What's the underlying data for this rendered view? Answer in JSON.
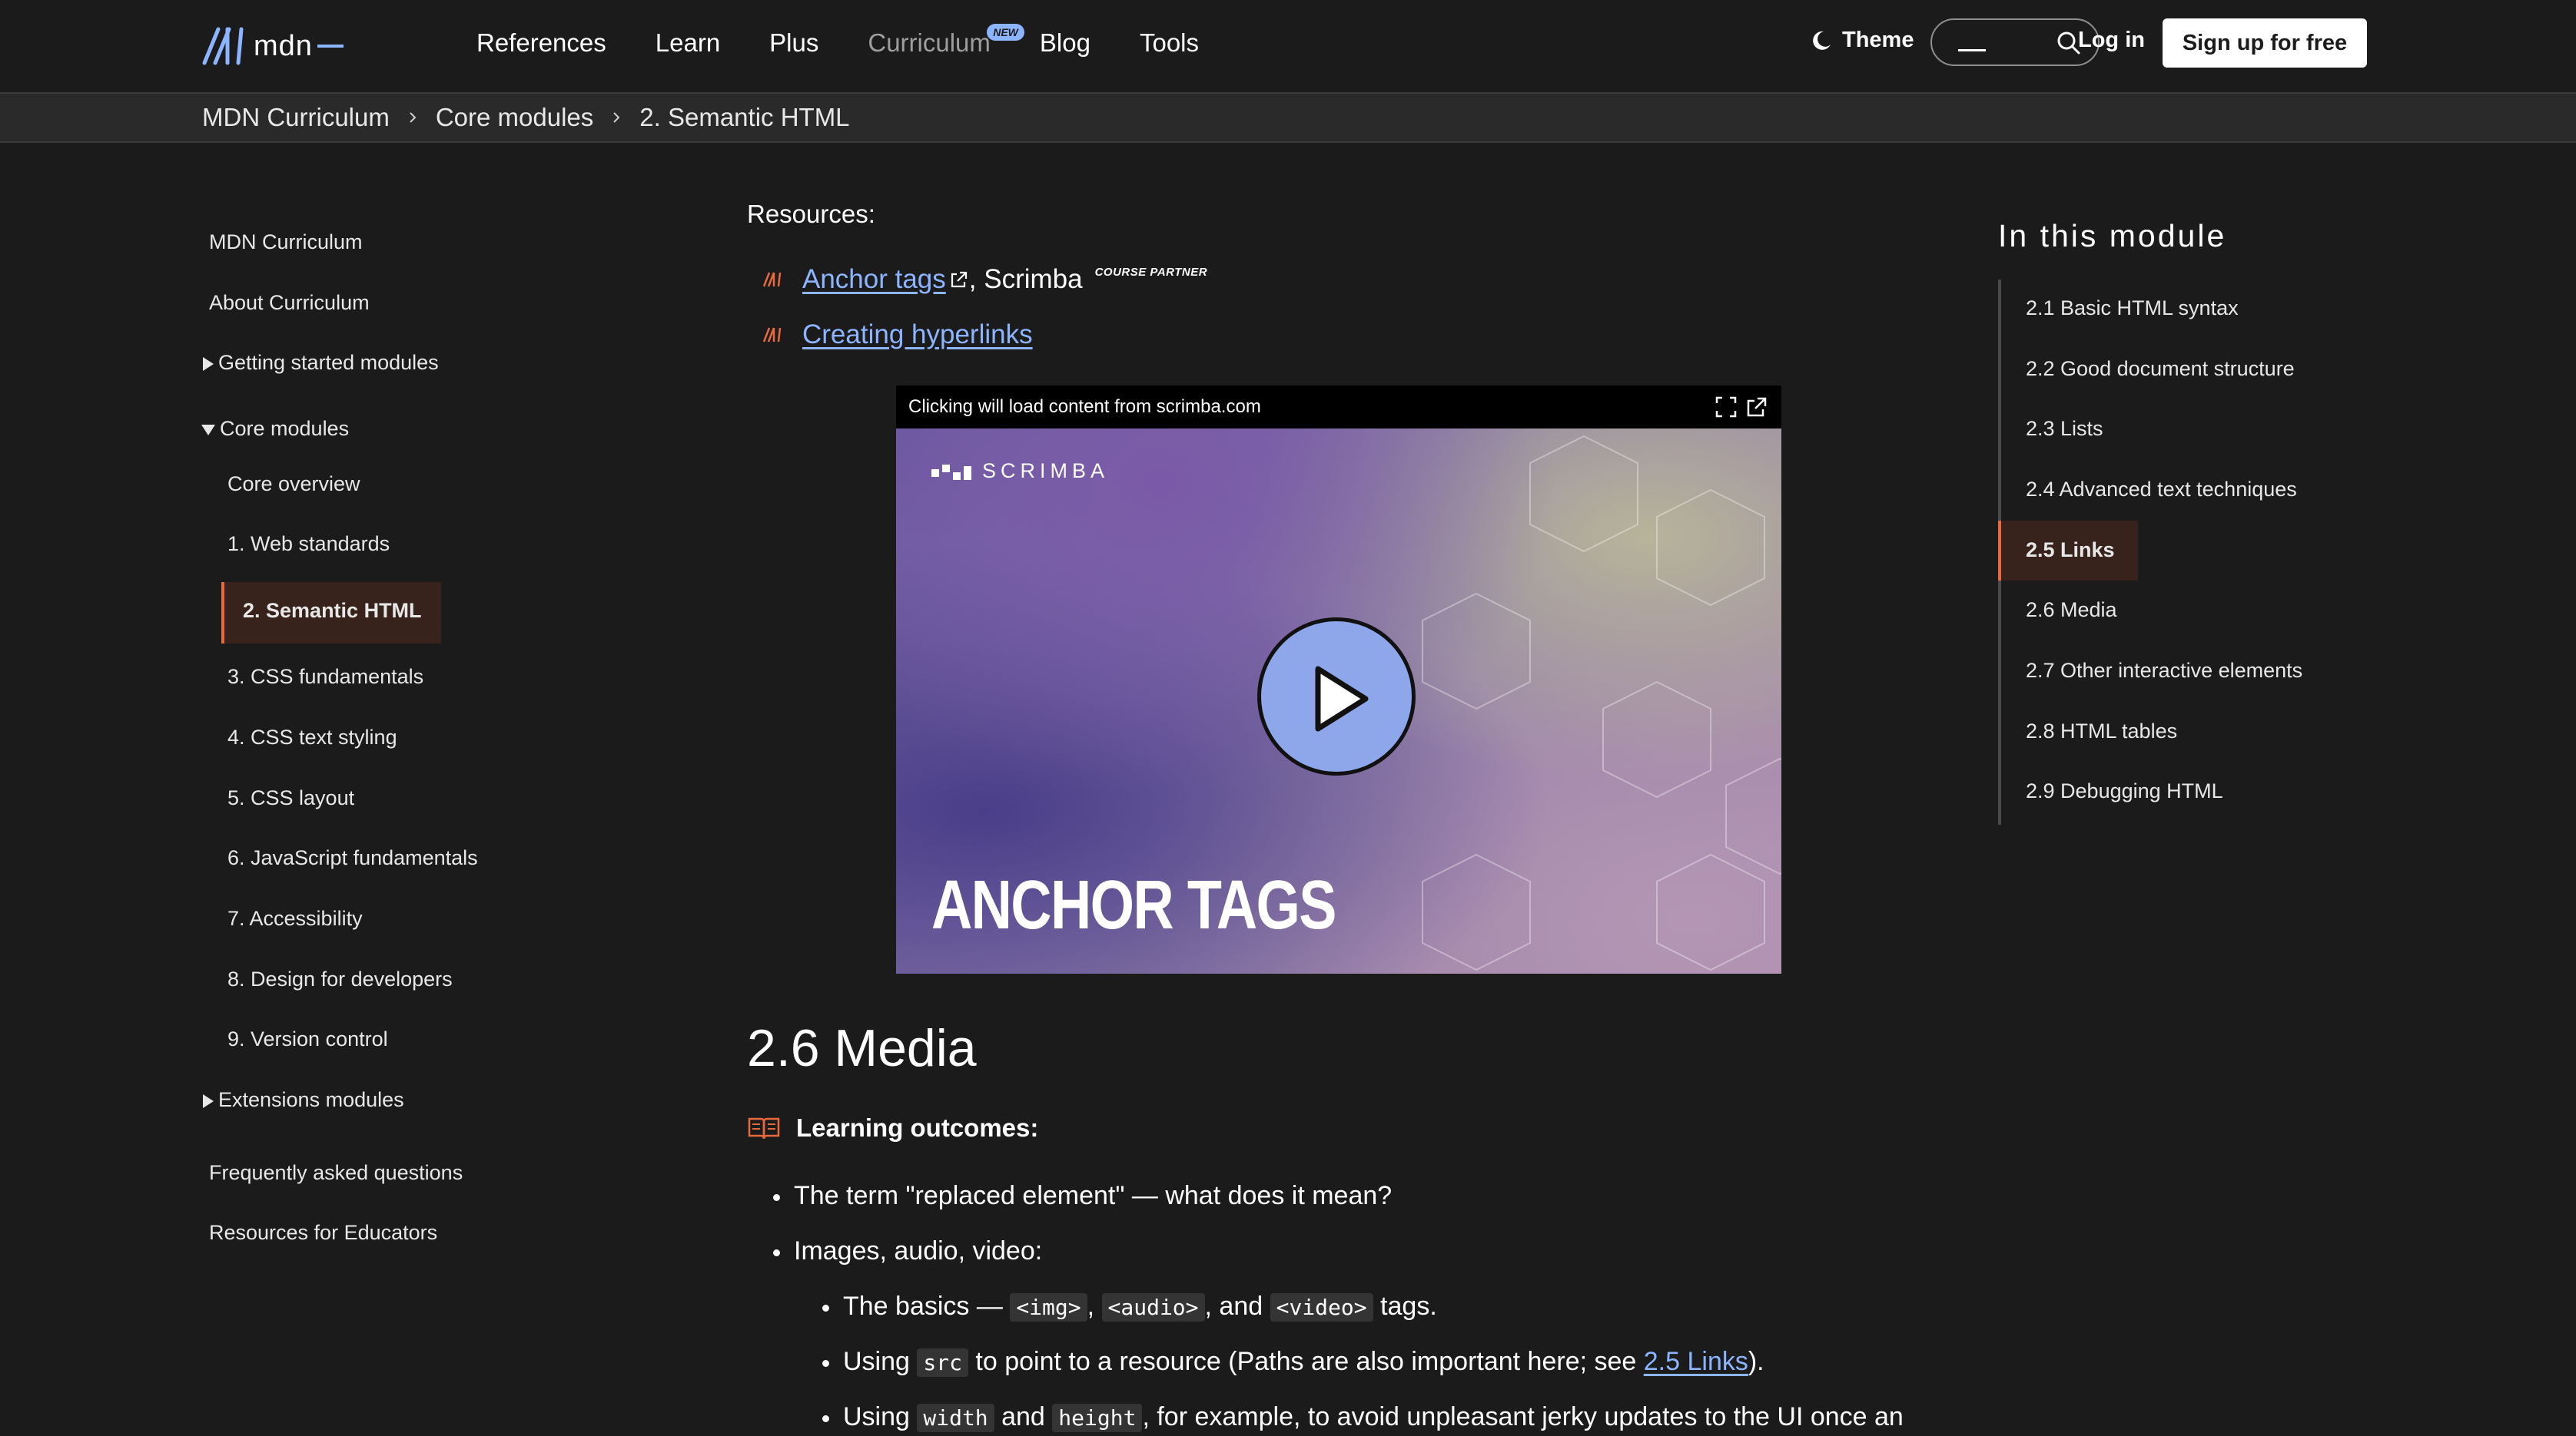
{
  "header": {
    "logo_text": "mdn",
    "nav": [
      {
        "label": "References"
      },
      {
        "label": "Learn"
      },
      {
        "label": "Plus"
      },
      {
        "label": "Curriculum",
        "badge": "NEW"
      },
      {
        "label": "Blog"
      },
      {
        "label": "Tools"
      }
    ],
    "theme_label": "Theme",
    "search_value": "",
    "login_label": "Log in",
    "signup_label": "Sign up for free"
  },
  "breadcrumb": [
    "MDN Curriculum",
    "Core modules",
    "2. Semantic HTML"
  ],
  "sidebar": {
    "items": [
      {
        "label": "MDN Curriculum"
      },
      {
        "label": "About Curriculum"
      },
      {
        "label": "Getting started modules",
        "expandable": "collapsed"
      },
      {
        "label": "Core modules",
        "expandable": "expanded"
      },
      {
        "label": "Core overview"
      },
      {
        "label": "1. Web standards"
      },
      {
        "label": "2. Semantic HTML",
        "active": true
      },
      {
        "label": "3. CSS fundamentals"
      },
      {
        "label": "4. CSS text styling"
      },
      {
        "label": "5. CSS layout"
      },
      {
        "label": "6. JavaScript fundamentals"
      },
      {
        "label": "7. Accessibility"
      },
      {
        "label": "8. Design for developers"
      },
      {
        "label": "9. Version control"
      },
      {
        "label": "Extensions modules",
        "expandable": "collapsed"
      },
      {
        "label": "Frequently asked questions"
      },
      {
        "label": "Resources for Educators"
      }
    ]
  },
  "main": {
    "resources_title": "Resources:",
    "resources": [
      {
        "link": "Anchor tags",
        "suffix": ", Scrimba",
        "tag": "COURSE PARTNER"
      },
      {
        "link": "Creating hyperlinks"
      }
    ],
    "video": {
      "notice": "Clicking will load content from scrimba.com",
      "brand": "SCRIMBA",
      "title": "ANCHOR TAGS"
    },
    "section_title": "2.6 Media",
    "learning_outcomes": "Learning outcomes:",
    "bullets": {
      "b1": "The term \"replaced element\" — what does it mean?",
      "b2": "Images, audio, video:",
      "s1_pre": "The basics — ",
      "s1_code1": "<img>",
      "s1_sep1": ", ",
      "s1_code2": "<audio>",
      "s1_sep2": ", and ",
      "s1_code3": "<video>",
      "s1_post": " tags.",
      "s2_pre": "Using ",
      "s2_code": "src",
      "s2_mid": " to point to a resource (Paths are also important here; see ",
      "s2_link": "2.5 Links",
      "s2_post": ").",
      "s3_pre": "Using ",
      "s3_code1": "width",
      "s3_mid": " and ",
      "s3_code2": "height",
      "s3_post": ", for example, to avoid unpleasant jerky updates to the UI once an"
    }
  },
  "toc": {
    "title": "In this module",
    "items": [
      {
        "label": "2.1 Basic HTML syntax"
      },
      {
        "label": "2.2 Good document structure"
      },
      {
        "label": "2.3 Lists"
      },
      {
        "label": "2.4 Advanced text techniques"
      },
      {
        "label": "2.5 Links",
        "active": true
      },
      {
        "label": "2.6 Media"
      },
      {
        "label": "2.7 Other interactive elements"
      },
      {
        "label": "2.8 HTML tables"
      },
      {
        "label": "2.9 Debugging HTML"
      }
    ]
  },
  "colors": {
    "accent_link": "#8cb4ff",
    "active_marker": "#e66a3c",
    "background": "#1b1b1b"
  }
}
